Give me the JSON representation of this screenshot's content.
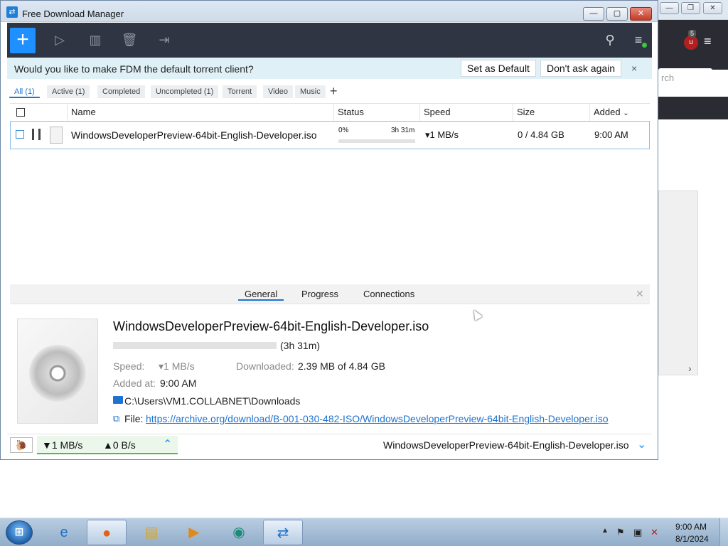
{
  "window": {
    "title": "Free Download Manager"
  },
  "toolbar": {
    "add_icon": "plus-icon",
    "start_icon": "play-icon",
    "stop_icon": "pause-icon",
    "delete_icon": "trash-icon",
    "move_icon": "folder-move-icon",
    "search_icon": "search-icon",
    "menu_icon": "hamburger-menu-icon"
  },
  "banner": {
    "question": "Would you like to make FDM the default torrent client?",
    "set_default": "Set as Default",
    "dont_ask": "Don't ask again",
    "close": "×"
  },
  "filters": [
    "All (1)",
    "Active (1)",
    "Completed",
    "Uncompleted (1)",
    "Torrent",
    "Video",
    "Music"
  ],
  "filter_add": "+",
  "columns": {
    "name": "Name",
    "status": "Status",
    "speed": "Speed",
    "size": "Size",
    "added": "Added"
  },
  "download": {
    "file_name": "WindowsDeveloperPreview-64bit-English-Developer.iso",
    "percent": "0%",
    "eta": "3h 31m",
    "speed": "▾1 MB/s",
    "size": "0 / 4.84 GB",
    "added": "9:00 AM"
  },
  "details": {
    "tabs": [
      "General",
      "Progress",
      "Connections"
    ],
    "close": "✕",
    "title": "WindowsDeveloperPreview-64bit-English-Developer.iso",
    "eta": "(3h 31m)",
    "speed_label": "Speed:",
    "speed_value": "▾1 MB/s",
    "downloaded_label": "Downloaded:",
    "downloaded_value": "2.39 MB of 4.84 GB",
    "added_label": "Added at:",
    "added_value": "9:00 AM",
    "folder": "C:\\Users\\VM1.COLLABNET\\Downloads",
    "file_label": "File:",
    "file_url": "https://archive.org/download/B-001-030-482-ISO/WindowsDeveloperPreview-64bit-English-Developer.iso"
  },
  "statusbar": {
    "down_speed": "▼1 MB/s",
    "up_speed": "▲0 B/s",
    "current_file": "WindowsDeveloperPreview-64bit-English-Developer.iso"
  },
  "background_browser": {
    "search_placeholder": "rch",
    "badge_count": "5"
  },
  "taskbar": {
    "apps": [
      "internet-explorer-icon",
      "firefox-icon",
      "file-explorer-icon",
      "media-player-icon",
      "app-icon",
      "fdm-icon"
    ],
    "time": "9:00 AM",
    "date": "8/1/2024"
  },
  "colors": {
    "accent": "#1e90ff",
    "toolbar_bg": "#2f3542",
    "banner_bg": "#dff0f6",
    "speed_ok": "#3fc53f"
  }
}
